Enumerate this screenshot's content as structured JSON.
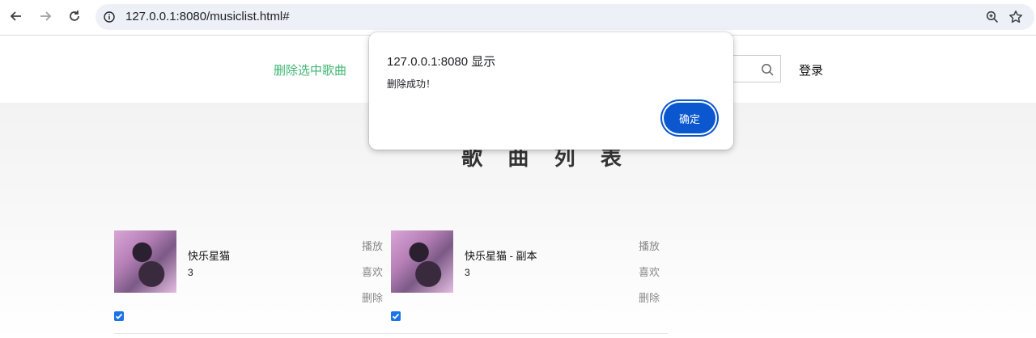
{
  "browser": {
    "url": "127.0.0.1:8080/musiclist.html#",
    "icons": [
      "back-icon",
      "forward-icon",
      "reload-icon",
      "site-info-icon",
      "zoom-icon",
      "bookmark-star-icon"
    ]
  },
  "header": {
    "delete_selected_label": "删除选中歌曲",
    "login_label": "登录",
    "accent_color": "#3fb673"
  },
  "main": {
    "title": "歌 曲 列 表",
    "songs": [
      {
        "name": "快乐星猫",
        "count": "3",
        "play_label": "播放",
        "like_label": "喜欢",
        "delete_label": "删除",
        "checked": true
      },
      {
        "name": "快乐星猫 - 副本",
        "count": "3",
        "play_label": "播放",
        "like_label": "喜欢",
        "delete_label": "删除",
        "checked": true
      }
    ]
  },
  "dialog": {
    "title": "127.0.0.1:8080 显示",
    "message": "删除成功！",
    "ok_label": "确定",
    "button_color": "#0b57d0"
  }
}
